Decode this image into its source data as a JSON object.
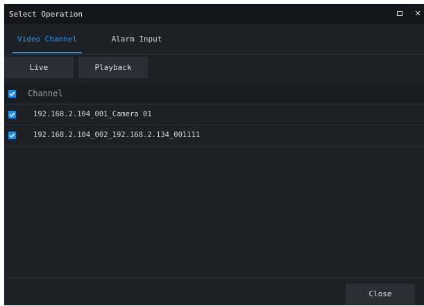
{
  "window": {
    "title": "Select Operation"
  },
  "tabs": [
    {
      "label": "Video Channel",
      "active": true
    },
    {
      "label": "Alarm Input",
      "active": false
    }
  ],
  "toolbar": {
    "live_label": "Live",
    "playback_label": "Playback"
  },
  "table": {
    "header": {
      "label": "Channel",
      "checked": true
    },
    "rows": [
      {
        "label": "192.168.2.104_001_Camera 01",
        "checked": true
      },
      {
        "label": "192.168.2.104_002_192.168.2.134_001111",
        "checked": true
      }
    ]
  },
  "footer": {
    "close_label": "Close"
  },
  "colors": {
    "accent": "#2f93e8",
    "dialog_bg": "#1d2125",
    "titlebar_bg": "#15181b",
    "button_bg": "#2a2f35"
  },
  "icons": {
    "maximize": "maximize-icon",
    "close": "close-icon",
    "checkbox": "checkbox-checked-icon"
  }
}
